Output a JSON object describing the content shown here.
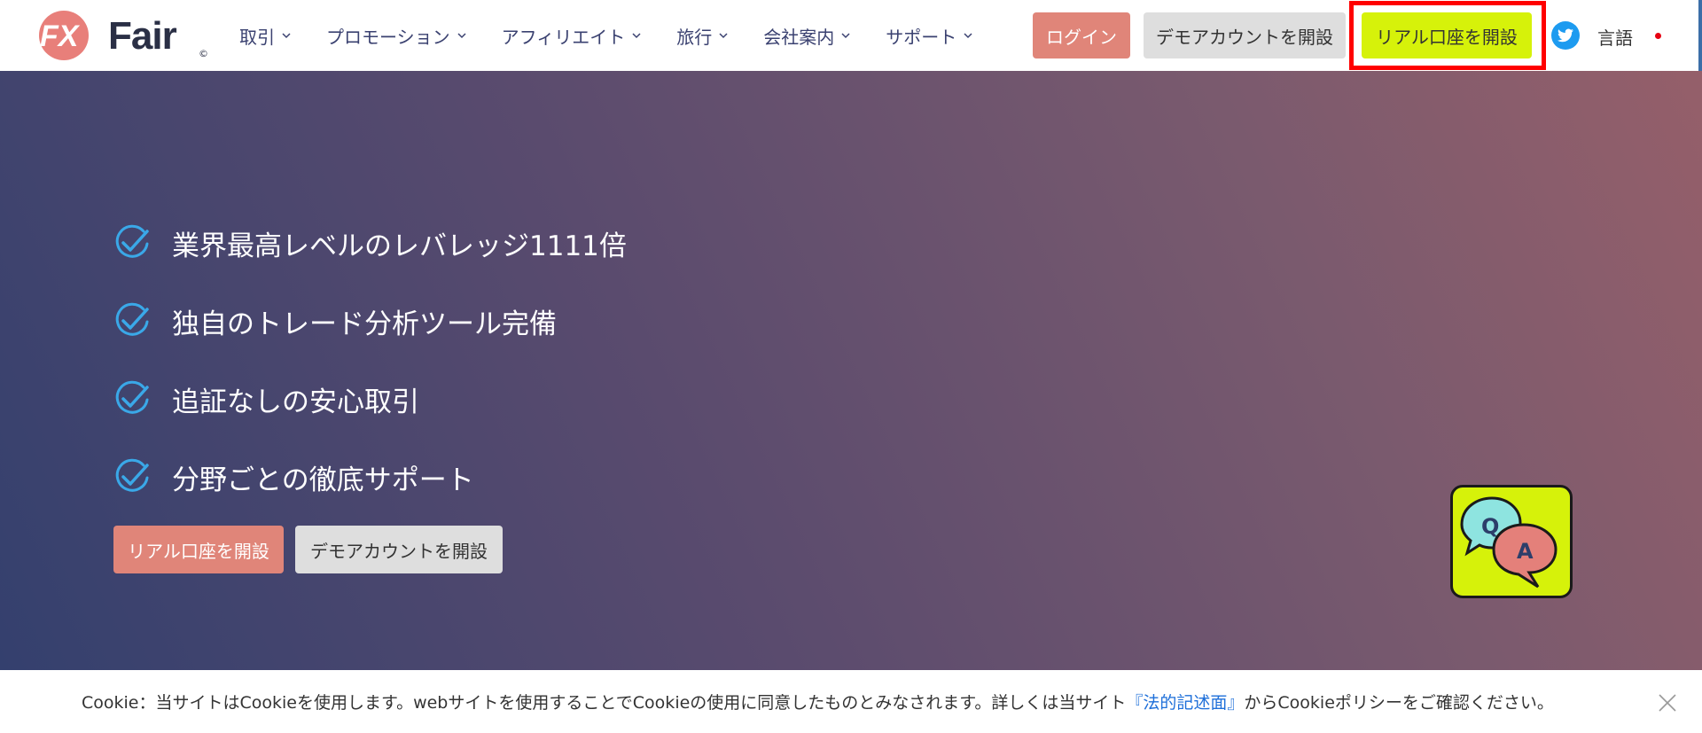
{
  "brand": {
    "logo_text": "Fair",
    "logo_mark": "FX",
    "logo_reg": "©",
    "accent": "#e08579"
  },
  "nav": {
    "items": [
      {
        "label": "取引"
      },
      {
        "label": "プロモーション"
      },
      {
        "label": "アフィリエイト"
      },
      {
        "label": "旅行"
      },
      {
        "label": "会社案内"
      },
      {
        "label": "サポート"
      }
    ]
  },
  "header": {
    "login_label": "ログイン",
    "demo_label": "デモアカウントを開設",
    "real_label": "リアル口座を開設",
    "language_label": "言語"
  },
  "hero": {
    "features": [
      "業界最高レベルのレバレッジ1111倍",
      "独自のトレード分析ツール完備",
      "追証なしの安心取引",
      "分野ごとの徹底サポート"
    ],
    "real_label": "リアル口座を開設",
    "demo_label": "デモアカウントを開設"
  },
  "qa_widget": {
    "q": "Q",
    "a": "A"
  },
  "cookie": {
    "text_before": "Cookie：当サイトはCookieを使用します。webサイトを使用することでCookieの使用に同意したものとみなされます。詳しくは当サイト",
    "link": "『法的記述面』",
    "text_after": "からCookieポリシーをご確認ください。"
  },
  "colors": {
    "highlight": "#d6f20a",
    "login": "#e08579",
    "twitter": "#1d9bf0"
  }
}
